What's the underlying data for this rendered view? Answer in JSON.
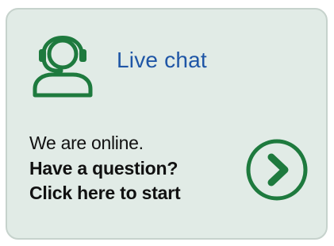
{
  "widget": {
    "title": "Live chat",
    "status_text": "We are online.",
    "question_text": "Have a question?",
    "cta_text": "Click here to start",
    "icons": {
      "agent": "headset-agent-icon",
      "start": "chevron-right-circle-icon"
    },
    "colors": {
      "accent_green": "#1e7a3e",
      "title_blue": "#1f56a6",
      "background": "#e1ebe6"
    }
  }
}
